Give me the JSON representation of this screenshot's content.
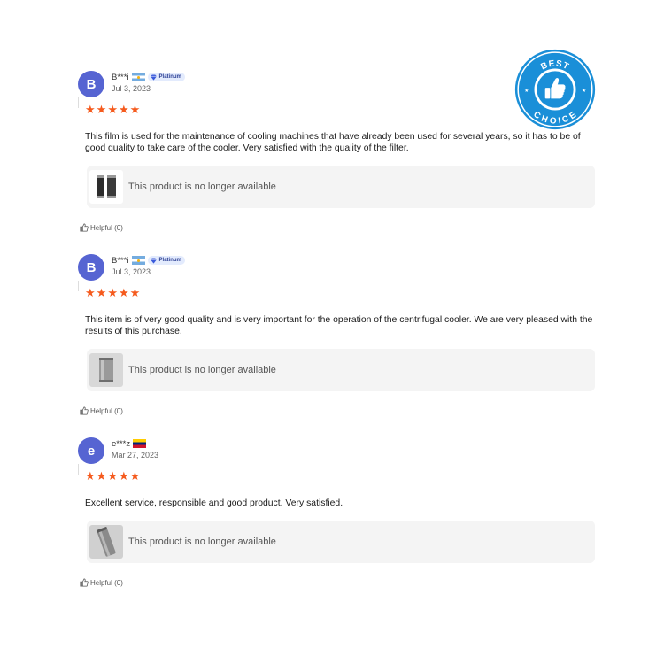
{
  "reviews": [
    {
      "avatar": "B",
      "name": "B***i",
      "flag": "flag-argentina-icon",
      "badge": "Platinum",
      "date": "Jul 3, 2023",
      "rating": 5,
      "text": "This film is used for the maintenance of cooling machines that have already been used for several years, so it has to be of good quality to take care of the cooler. Very satisfied with the quality of the filter.",
      "product_status": "This product is no longer available",
      "helpful": "Helpful (0)"
    },
    {
      "avatar": "B",
      "name": "B***i",
      "flag": "flag-argentina-icon",
      "badge": "Platinum",
      "date": "Jul 3, 2023",
      "rating": 5,
      "text": "This item is of very good quality and is very important for the operation of the centrifugal cooler. We are very pleased with the results of this purchase.",
      "product_status": "This product is no longer available",
      "helpful": "Helpful (0)"
    },
    {
      "avatar": "e",
      "name": "e***z",
      "flag": "flag-venezuela-icon",
      "date": "Mar 27, 2023",
      "rating": 5,
      "text": "Excellent service, responsible and good product. Very satisfied.",
      "product_status": "This product is no longer available",
      "helpful": "Helpful (0)"
    }
  ],
  "seal": {
    "top_text": "BEST",
    "bottom_text": "CHOICE",
    "color": "#1a8fd8"
  },
  "colors": {
    "avatar": "#5664d2",
    "star": "#f55a1d",
    "badge_bg": "#e3ebfd",
    "badge_text": "#2b3f94"
  }
}
